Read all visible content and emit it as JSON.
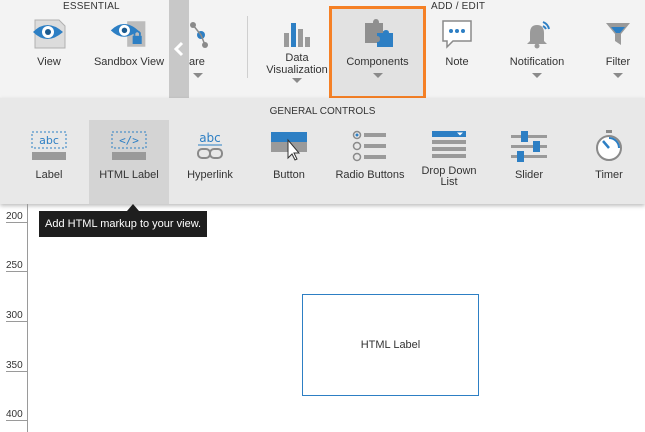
{
  "ribbon": {
    "essential_label": "ESSENTIAL",
    "add_edit_label": "ADD / EDIT",
    "buttons": [
      {
        "label": "View",
        "icon": "eye-icon"
      },
      {
        "label": "Sandbox View",
        "icon": "eye-lock-icon"
      },
      {
        "label": "are",
        "icon": "share-icon"
      },
      {
        "label": "Data Visualization",
        "icon": "bar-chart-icon"
      },
      {
        "label": "Components",
        "icon": "puzzle-icon"
      },
      {
        "label": "Note",
        "icon": "note-icon"
      },
      {
        "label": "Notification",
        "icon": "bell-icon"
      },
      {
        "label": "Filter",
        "icon": "funnel-icon"
      }
    ],
    "collapse_icon": "chevron-left-icon",
    "highlight_color": "#f58025"
  },
  "panel": {
    "title": "GENERAL CONTROLS",
    "controls": [
      {
        "label": "Label",
        "icon": "label-icon"
      },
      {
        "label": "HTML Label",
        "icon": "html-label-icon"
      },
      {
        "label": "Hyperlink",
        "icon": "hyperlink-icon"
      },
      {
        "label": "Button",
        "icon": "button-icon"
      },
      {
        "label": "Radio Buttons",
        "icon": "radio-buttons-icon"
      },
      {
        "label": "Drop Down",
        "label2": "List",
        "icon": "dropdown-list-icon"
      },
      {
        "label": "Slider",
        "icon": "slider-icon"
      },
      {
        "label": "Timer",
        "icon": "timer-icon"
      }
    ]
  },
  "tooltip": {
    "text": "Add HTML markup to your view."
  },
  "ruler": {
    "ticks": [
      "200",
      "250",
      "300",
      "350",
      "400"
    ]
  },
  "canvas": {
    "widget_text": "HTML Label"
  },
  "colors": {
    "icon_blue": "#2d7fc4",
    "icon_gray": "#7a7a7a"
  }
}
